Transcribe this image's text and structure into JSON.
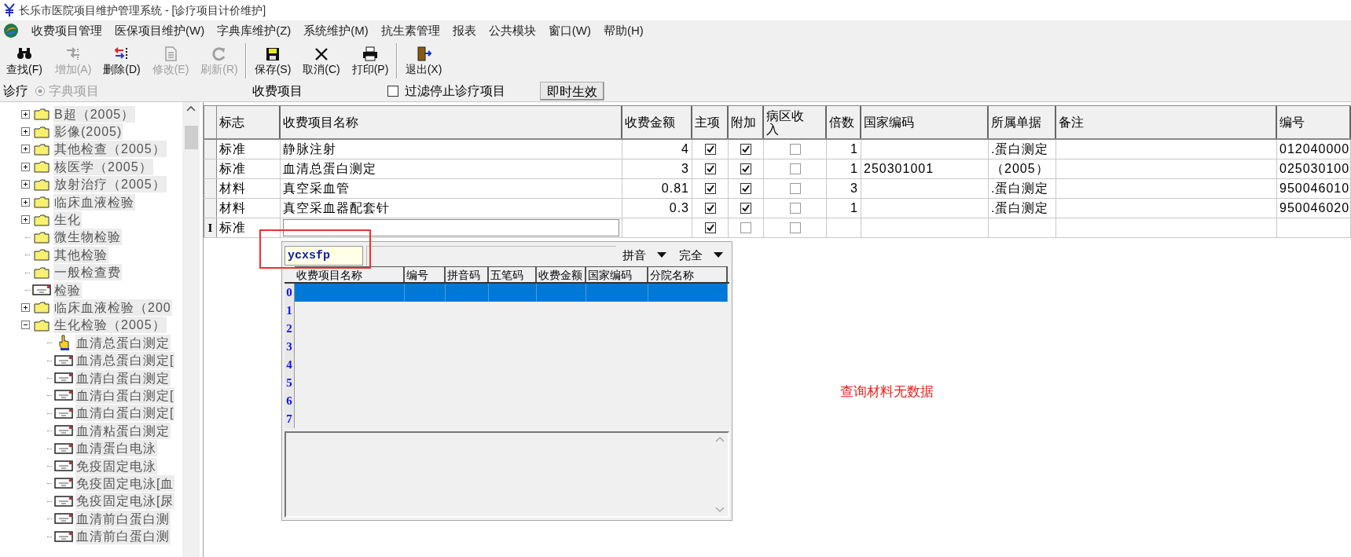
{
  "window": {
    "title": "长乐市医院项目维护管理系统 - [诊疗项目计价维护]"
  },
  "menu": [
    "收费项目管理",
    "医保项目维护(W)",
    "字典库维护(Z)",
    "系统维护(M)",
    "抗生素管理",
    "报表",
    "公共模块",
    "窗口(W)",
    "帮助(H)"
  ],
  "toolbar": [
    [
      {
        "label": "查找(F)",
        "kind": "find",
        "disabled": false
      },
      {
        "label": "增加(A)",
        "kind": "add",
        "disabled": true
      },
      {
        "label": "删除(D)",
        "kind": "delete",
        "disabled": false
      },
      {
        "label": "修改(E)",
        "kind": "edit",
        "disabled": true
      },
      {
        "label": "刷新(R)",
        "kind": "refresh",
        "disabled": true
      }
    ],
    [
      {
        "label": "保存(S)",
        "kind": "save",
        "disabled": false
      },
      {
        "label": "取消(C)",
        "kind": "cancel",
        "disabled": false
      },
      {
        "label": "打印(P)",
        "kind": "print",
        "disabled": false
      }
    ],
    [
      {
        "label": "退出(X)",
        "kind": "exit",
        "disabled": false
      }
    ]
  ],
  "filter_bar": {
    "label": "诊疗",
    "radio": {
      "label": "字典项目",
      "selected": true,
      "disabled": true
    },
    "section_title": "收费项目",
    "filter_checkbox": {
      "label": "过滤停止诊疗项目",
      "checked": false
    },
    "apply_button": "即时生效"
  },
  "tree": [
    {
      "label": "B超（2005）",
      "kind": "folder",
      "expanded": false
    },
    {
      "label": "影像(2005)",
      "kind": "folder",
      "expanded": false
    },
    {
      "label": "其他检查（2005）",
      "kind": "folder",
      "expanded": false
    },
    {
      "label": "核医学（2005）",
      "kind": "folder",
      "expanded": false
    },
    {
      "label": "放射治疗（2005）",
      "kind": "folder",
      "expanded": false
    },
    {
      "label": "临床血液检验",
      "kind": "folder",
      "expanded": false
    },
    {
      "label": "生化",
      "kind": "folder",
      "expanded": false
    },
    {
      "label": "微生物检验",
      "kind": "folder"
    },
    {
      "label": "其他检验",
      "kind": "folder"
    },
    {
      "label": "一般检查费",
      "kind": "folder"
    },
    {
      "label": "检验",
      "kind": "record"
    },
    {
      "label": "临床血液检验（200",
      "kind": "folder",
      "expanded": false
    },
    {
      "label": "生化检验（2005）",
      "kind": "folder",
      "expanded": true,
      "children": [
        {
          "label": "血清总蛋白测定",
          "kind": "pointer"
        },
        {
          "label": "血清总蛋白测定[",
          "kind": "record"
        },
        {
          "label": "血清白蛋白测定",
          "kind": "record"
        },
        {
          "label": "血清白蛋白测定[",
          "kind": "record"
        },
        {
          "label": "血清白蛋白测定[",
          "kind": "record"
        },
        {
          "label": "血清粘蛋白测定",
          "kind": "record"
        },
        {
          "label": "血清蛋白电泳",
          "kind": "record"
        },
        {
          "label": "免疫固定电泳",
          "kind": "record"
        },
        {
          "label": "免疫固定电泳[血",
          "kind": "record"
        },
        {
          "label": "免疫固定电泳[尿",
          "kind": "record"
        },
        {
          "label": "血清前白蛋白测",
          "kind": "record"
        },
        {
          "label": "血清前白蛋白测",
          "kind": "record"
        }
      ]
    }
  ],
  "grid": {
    "columns": [
      "标志",
      "收费项目名称",
      "收费金额",
      "主项",
      "附加",
      "病区收入",
      "倍数",
      "国家编码",
      "所属单据",
      "备注",
      "编号"
    ],
    "rows": [
      {
        "flag": "标准",
        "name": "静脉注射",
        "amount": "4",
        "main": true,
        "extra": true,
        "ward_income": false,
        "multiplier": "1",
        "document": ".蛋白测定",
        "code": "012040000"
      },
      {
        "flag": "标准",
        "name": "血清总蛋白测定",
        "amount": "3",
        "main": true,
        "extra": true,
        "ward_income": false,
        "multiplier": "1",
        "national_code": "250301001",
        "document": "（2005）",
        "code": "025030100"
      },
      {
        "flag": "材料",
        "name": "真空采血管",
        "amount": "0.81",
        "main": true,
        "extra": true,
        "ward_income": false,
        "multiplier": "3",
        "document": ".蛋白测定",
        "code": "950046010"
      },
      {
        "flag": "材料",
        "name": "真空采血器配套针",
        "amount": "0.3",
        "main": true,
        "extra": true,
        "ward_income": false,
        "multiplier": "1",
        "document": ".蛋白测定",
        "code": "950046020"
      },
      {
        "marker": "I",
        "flag": "标准",
        "main": true,
        "extra": false,
        "ward_income": false,
        "editing": true
      }
    ]
  },
  "lookup_popup": {
    "search_value": "ycxsfp",
    "options": [
      "拼音",
      "完全"
    ],
    "columns": [
      "收费项目名称",
      "编号",
      "拼音码",
      "五笔码",
      "收费金额",
      "国家编码",
      "分院名称"
    ],
    "rows": [
      {
        "number": "0",
        "selected": true
      },
      {
        "number": "1",
        "selected": false
      },
      {
        "number": "2",
        "selected": false
      },
      {
        "number": "3",
        "selected": false
      },
      {
        "number": "4",
        "selected": false
      },
      {
        "number": "5",
        "selected": false
      },
      {
        "number": "6",
        "selected": false
      },
      {
        "number": "7",
        "selected": false
      }
    ]
  },
  "annotation": {
    "text": "查询材料无数据"
  }
}
